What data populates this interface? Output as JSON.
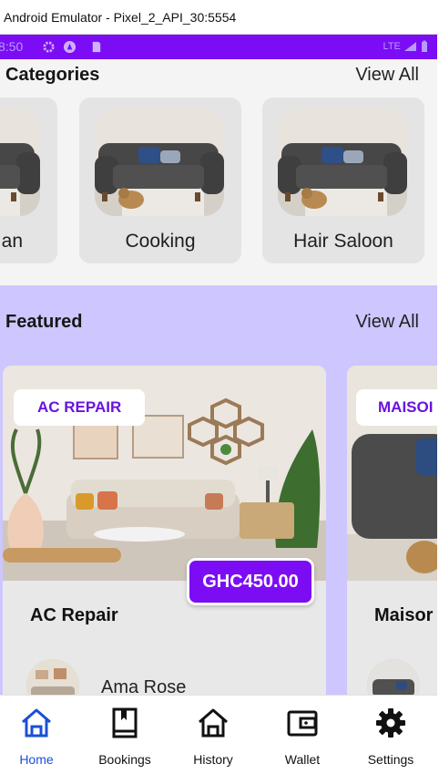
{
  "window": {
    "title": "Android Emulator - Pixel_2_API_30:5554"
  },
  "status_bar": {
    "time": "8:50",
    "network": "LTE"
  },
  "categories": {
    "title": "Categories",
    "view_all": "View All",
    "items": [
      {
        "label": "an"
      },
      {
        "label": "Cooking"
      },
      {
        "label": "Hair Saloon"
      }
    ]
  },
  "featured": {
    "title": "Featured",
    "view_all": "View All",
    "cards": [
      {
        "tag": "AC REPAIR",
        "price": "GHC450.00",
        "title": "AC Repair",
        "owner": "Ama Rose"
      },
      {
        "tag": "MAISOI",
        "title": "Maisor"
      }
    ]
  },
  "bottom_nav": {
    "active_color": "#1a4fd6",
    "items": [
      {
        "label": "Home",
        "icon": "home-icon",
        "active": true
      },
      {
        "label": "Bookings",
        "icon": "book-icon",
        "active": false
      },
      {
        "label": "History",
        "icon": "history-home-icon",
        "active": false
      },
      {
        "label": "Wallet",
        "icon": "wallet-icon",
        "active": false
      },
      {
        "label": "Settings",
        "icon": "gear-icon",
        "active": false
      }
    ]
  },
  "colors": {
    "accent": "#7b0cf4",
    "featured_bg": "#cdc6ff",
    "card_bg": "#e4e4e4"
  }
}
